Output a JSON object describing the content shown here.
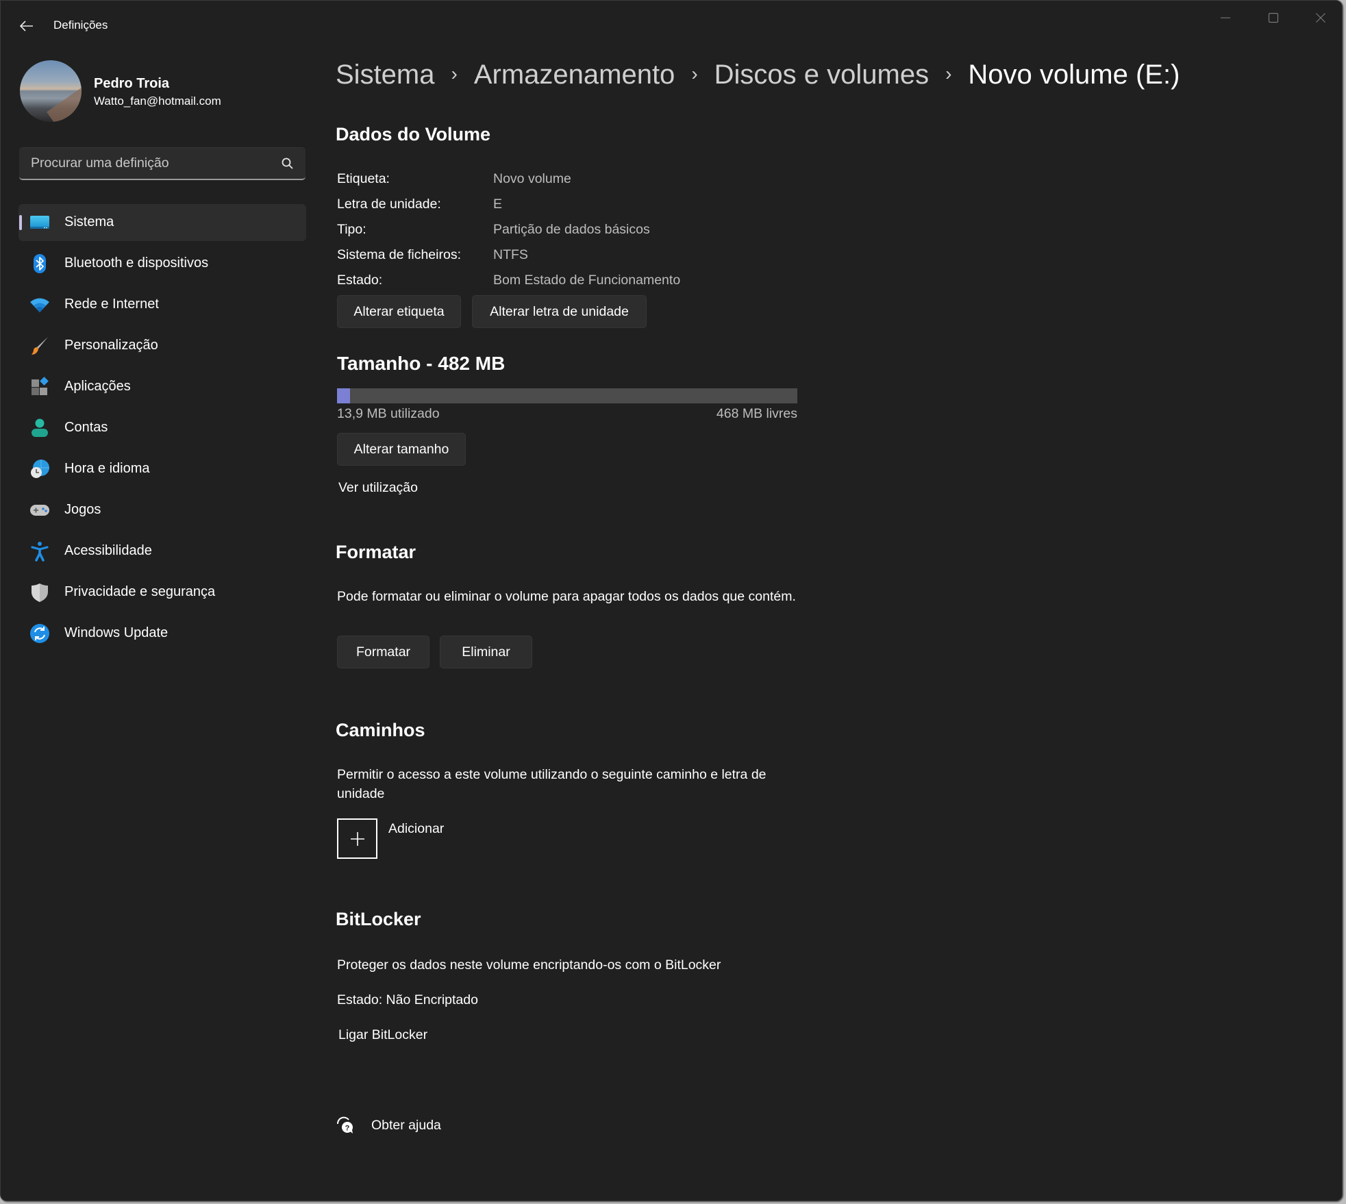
{
  "window": {
    "title": "Definições",
    "controls": [
      "minimize",
      "maximize",
      "close"
    ]
  },
  "profile": {
    "name": "Pedro Troia",
    "email": "Watto_fan@hotmail.com"
  },
  "search": {
    "placeholder": "Procurar uma definição",
    "value": ""
  },
  "sidebar": {
    "items": [
      {
        "label": "Sistema",
        "icon": "system-display-icon",
        "selected": true
      },
      {
        "label": "Bluetooth e dispositivos",
        "icon": "bluetooth-icon",
        "selected": false
      },
      {
        "label": "Rede e Internet",
        "icon": "wifi-icon",
        "selected": false
      },
      {
        "label": "Personalização",
        "icon": "paintbrush-icon",
        "selected": false
      },
      {
        "label": "Aplicações",
        "icon": "apps-icon",
        "selected": false
      },
      {
        "label": "Contas",
        "icon": "person-icon",
        "selected": false
      },
      {
        "label": "Hora e idioma",
        "icon": "globe-clock-icon",
        "selected": false
      },
      {
        "label": "Jogos",
        "icon": "gamepad-icon",
        "selected": false
      },
      {
        "label": "Acessibilidade",
        "icon": "accessibility-icon",
        "selected": false
      },
      {
        "label": "Privacidade e segurança",
        "icon": "shield-icon",
        "selected": false
      },
      {
        "label": "Windows Update",
        "icon": "update-icon",
        "selected": false
      }
    ]
  },
  "breadcrumb": {
    "items": [
      "Sistema",
      "Armazenamento",
      "Discos e volumes",
      "Novo volume (E:)"
    ],
    "separator": "›"
  },
  "volume_data": {
    "heading": "Dados do Volume",
    "properties": [
      {
        "label": "Etiqueta:",
        "value": "Novo volume"
      },
      {
        "label": "Letra de unidade:",
        "value": "E"
      },
      {
        "label": "Tipo:",
        "value": "Partição de dados básicos"
      },
      {
        "label": "Sistema de ficheiros:",
        "value": "NTFS"
      },
      {
        "label": "Estado:",
        "value": "Bom Estado de Funcionamento"
      }
    ],
    "buttons": {
      "change_label": "Alterar etiqueta",
      "change_letter": "Alterar letra de unidade"
    }
  },
  "size": {
    "heading": "Tamanho - 482 MB",
    "used_label": "13,9 MB utilizado",
    "free_label": "468 MB livres",
    "used_mb": 13.9,
    "total_mb": 482,
    "used_fraction": 0.029,
    "fill_color": "#7b80d4",
    "resize_button": "Alterar tamanho",
    "view_usage_link": "Ver utilização"
  },
  "format": {
    "heading": "Formatar",
    "description": "Pode formatar ou eliminar o volume para apagar todos os dados que contém.",
    "format_button": "Formatar",
    "delete_button": "Eliminar"
  },
  "paths": {
    "heading": "Caminhos",
    "description": "Permitir o acesso a este volume utilizando o seguinte caminho e letra de unidade",
    "add_label": "Adicionar"
  },
  "bitlocker": {
    "heading": "BitLocker",
    "description": "Proteger os dados neste volume encriptando-os com o BitLocker",
    "status": "Estado: Não Encriptado",
    "turn_on_link": "Ligar BitLocker"
  },
  "help": {
    "label": "Obter ajuda"
  }
}
